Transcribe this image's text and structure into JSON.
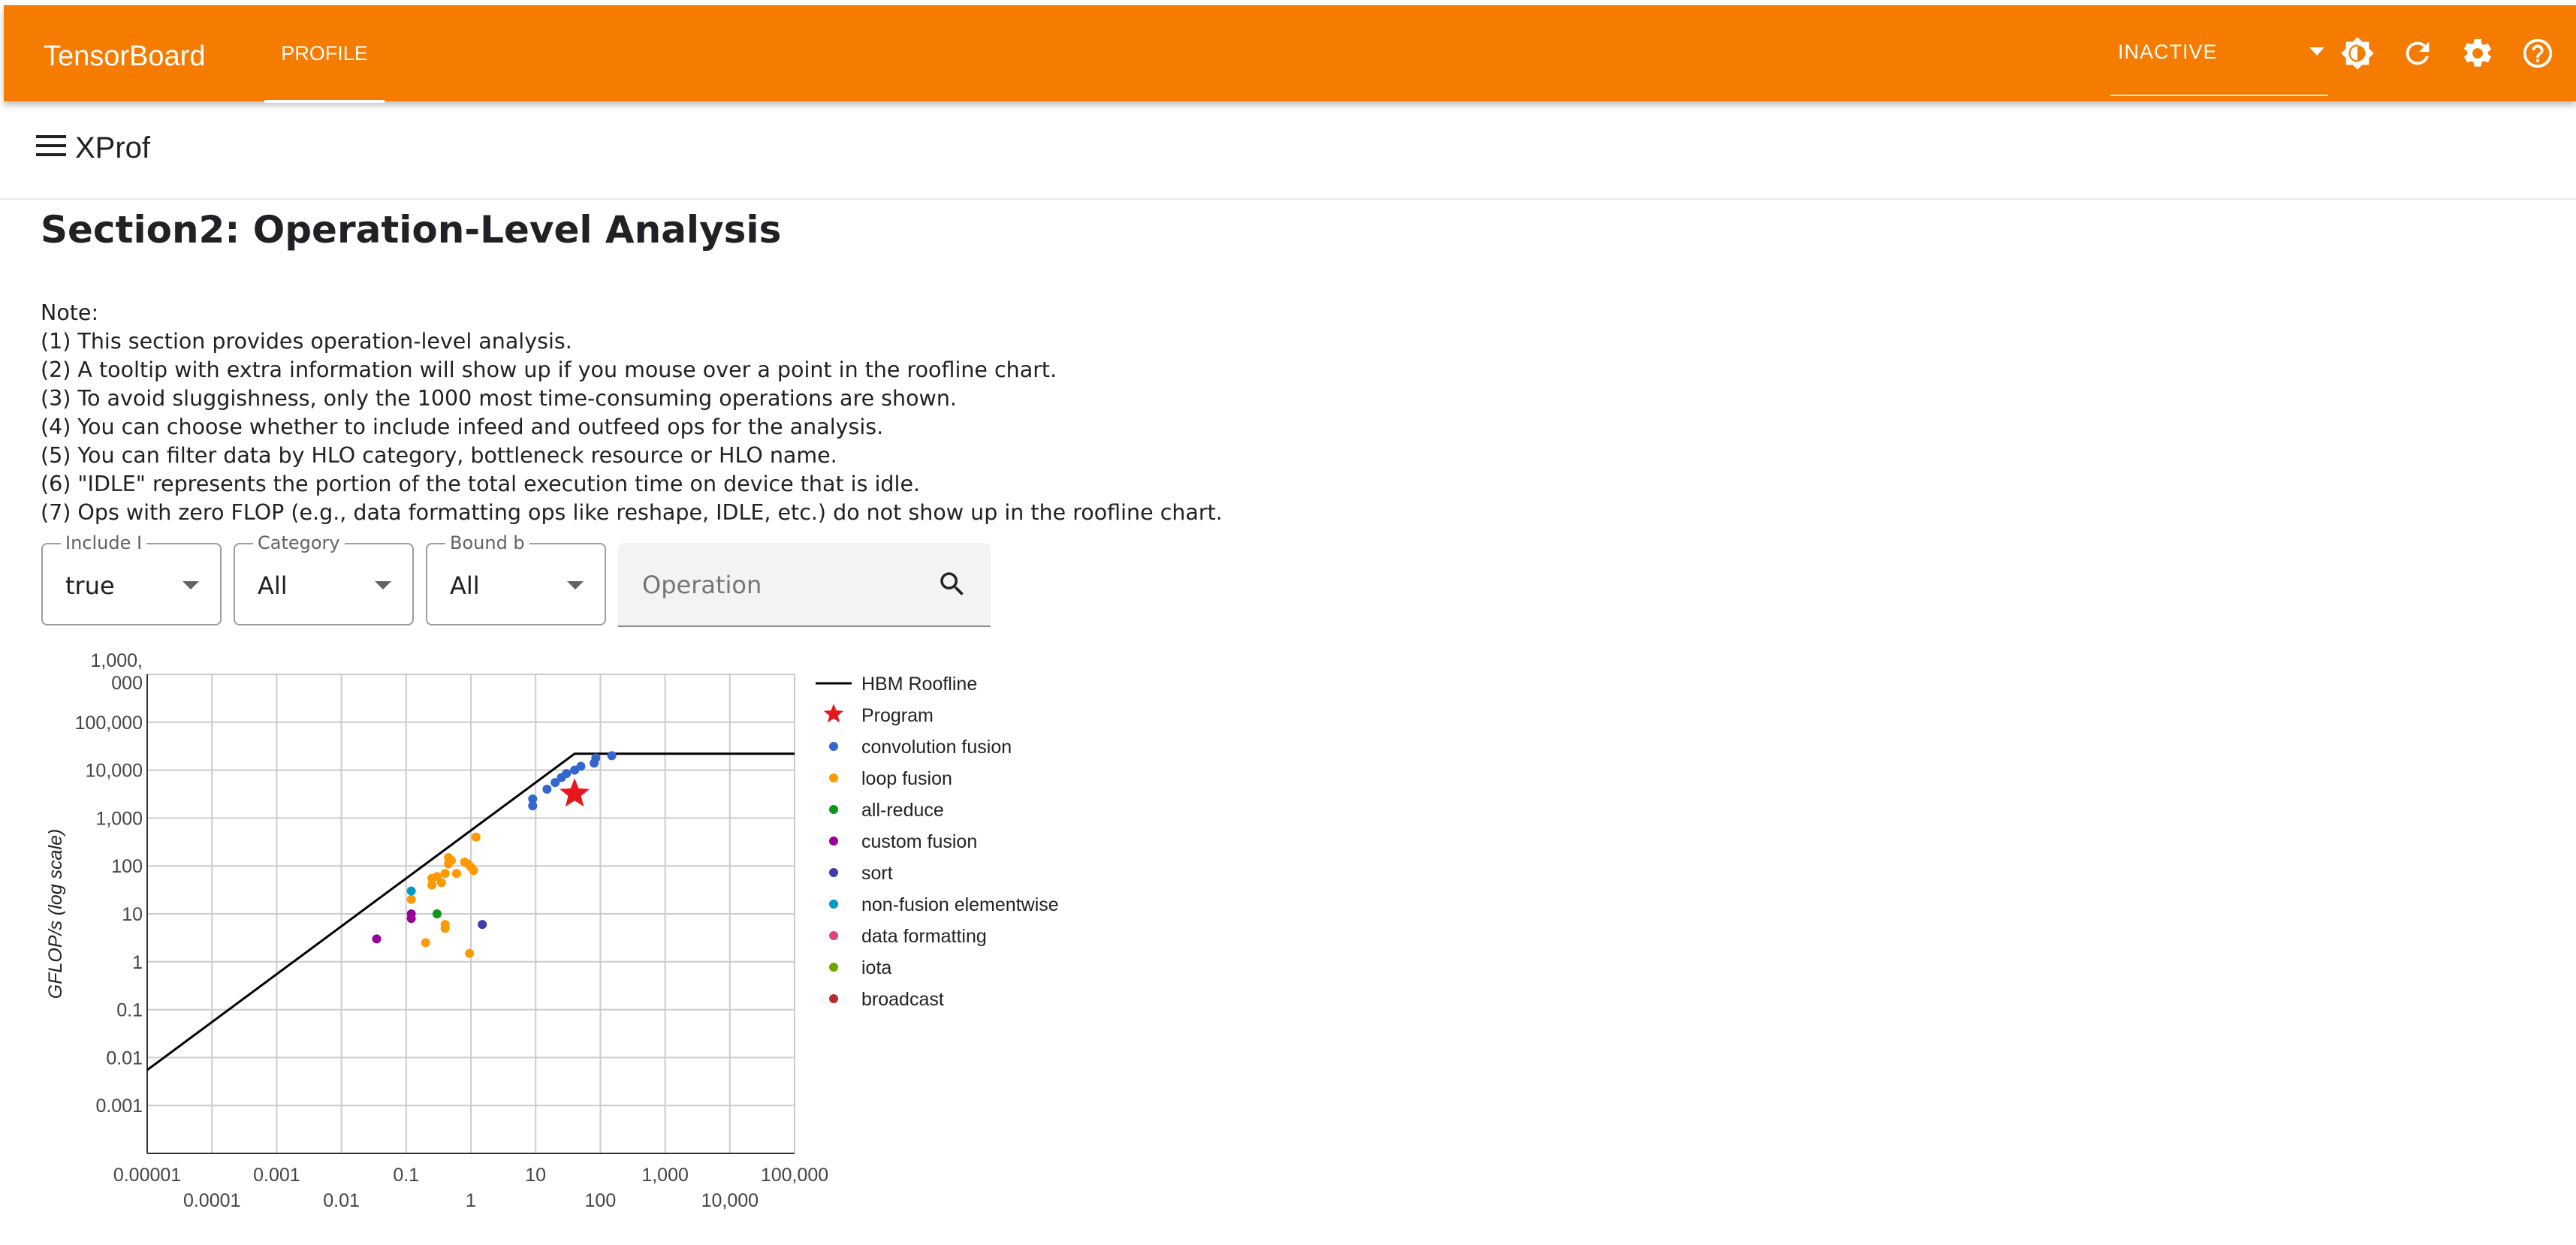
{
  "app": {
    "brand": "TensorBoard",
    "tab": "PROFILE",
    "run_selector": "INACTIVE",
    "header_icons": [
      "brightness-icon",
      "refresh-icon",
      "settings-icon",
      "help-icon"
    ],
    "accent_color": "#f57c00"
  },
  "toolbar": {
    "menu_icon": "menu-icon",
    "title": "XProf"
  },
  "section": {
    "title": "Section2: Operation-Level Analysis",
    "notes": [
      "Note:",
      "(1) This section provides operation-level analysis.",
      "(2) A tooltip with extra information will show up if you mouse over a point in the roofline chart.",
      "(3) To avoid sluggishness, only the 1000 most time-consuming operations are shown.",
      "(4) You can choose whether to include infeed and outfeed ops for the analysis.",
      "(5) You can filter data by HLO category, bottleneck resource or HLO name.",
      "(6) \"IDLE\" represents the portion of the total execution time on device that is idle.",
      "(7) Ops with zero FLOP (e.g., data formatting ops like reshape, IDLE, etc.) do not show up in the roofline chart."
    ]
  },
  "filters": {
    "include_infeed": {
      "label": "Include I",
      "value": "true"
    },
    "category": {
      "label": "Category",
      "value": "All"
    },
    "bound_by": {
      "label": "Bound b",
      "value": "All"
    },
    "operation_search": {
      "placeholder": "Operation",
      "value": ""
    }
  },
  "chart_data": {
    "type": "scatter",
    "x_scale": "log",
    "y_scale": "log",
    "xlim": [
      1e-05,
      100000
    ],
    "ylim": [
      0.0001,
      1000000
    ],
    "ylabel": "GFLOP/s (log scale)",
    "x_ticks_upper": [
      "0.00001",
      "0.001",
      "0.1",
      "10",
      "1,000",
      "100,000"
    ],
    "x_ticks_lower": [
      "0.0001",
      "0.01",
      "1",
      "100",
      "10,000"
    ],
    "y_ticks": [
      "1,000,000",
      "100,000",
      "10,000",
      "1,000",
      "100",
      "10",
      "1",
      "0.1",
      "0.01",
      "0.001"
    ],
    "grid": true,
    "legend_position": "right",
    "roofline": {
      "name": "HBM Roofline",
      "color": "#000000",
      "points": [
        [
          1e-05,
          0.0055
        ],
        [
          40,
          22000
        ],
        [
          100000,
          22000
        ]
      ]
    },
    "series": [
      {
        "name": "Program",
        "marker": "star",
        "color": "#e8171c",
        "points": [
          [
            40,
            3200
          ]
        ]
      },
      {
        "name": "convolution fusion",
        "color": "#3366cc",
        "points": [
          [
            9,
            1800
          ],
          [
            9,
            2500
          ],
          [
            15,
            4000
          ],
          [
            20,
            5500
          ],
          [
            25,
            7000
          ],
          [
            30,
            8500
          ],
          [
            40,
            10000
          ],
          [
            50,
            12000
          ],
          [
            80,
            14000
          ],
          [
            85,
            18000
          ],
          [
            150,
            20000
          ]
        ]
      },
      {
        "name": "loop fusion",
        "color": "#ff9900",
        "points": [
          [
            0.12,
            20
          ],
          [
            0.2,
            2.5
          ],
          [
            0.25,
            40
          ],
          [
            0.25,
            55
          ],
          [
            0.3,
            60
          ],
          [
            0.35,
            45
          ],
          [
            0.4,
            70
          ],
          [
            0.45,
            110
          ],
          [
            0.45,
            150
          ],
          [
            0.5,
            130
          ],
          [
            0.4,
            5
          ],
          [
            0.4,
            6
          ],
          [
            0.6,
            70
          ],
          [
            0.8,
            120
          ],
          [
            0.9,
            110
          ],
          [
            1,
            95
          ],
          [
            1.1,
            80
          ],
          [
            1.2,
            400
          ],
          [
            0.95,
            1.5
          ]
        ]
      },
      {
        "name": "all-reduce",
        "color": "#109618",
        "points": [
          [
            0.3,
            10
          ]
        ]
      },
      {
        "name": "custom fusion",
        "color": "#990099",
        "points": [
          [
            0.035,
            3
          ],
          [
            0.12,
            8
          ],
          [
            0.12,
            10
          ]
        ]
      },
      {
        "name": "sort",
        "color": "#3b3eac",
        "points": [
          [
            1.5,
            6
          ]
        ]
      },
      {
        "name": "non-fusion elementwise",
        "color": "#0099c6",
        "points": [
          [
            0.12,
            30
          ]
        ]
      },
      {
        "name": "data formatting",
        "color": "#dd4477",
        "points": []
      },
      {
        "name": "iota",
        "color": "#66aa00",
        "points": []
      },
      {
        "name": "broadcast",
        "color": "#b82e2e",
        "points": []
      }
    ]
  }
}
